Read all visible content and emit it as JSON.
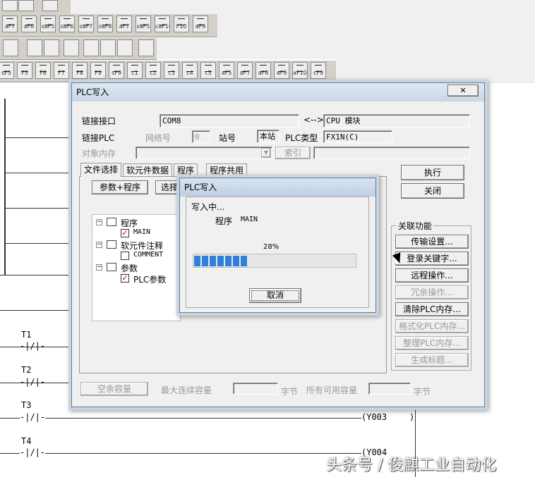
{
  "toolbar": {
    "row2": [
      "aF7",
      "aF8",
      "saF5",
      "saF6",
      "saF7",
      "saF8",
      "aF7",
      "saF5",
      "caF10",
      "F10",
      "aF9"
    ],
    "row4": [
      "sF5",
      "F5",
      "F6",
      "F7",
      "F8",
      "F9",
      "sF9",
      "c1",
      "c2",
      "c3",
      "c4",
      "c5",
      "aF5",
      "aF7",
      "aF8",
      "aF9",
      "aF10",
      "cF9"
    ]
  },
  "ladder": {
    "contacts": [
      "T1",
      "T2",
      "T3",
      "T4"
    ],
    "coils": [
      "Y003",
      "Y004"
    ]
  },
  "dialog": {
    "title": "PLC写入",
    "close_glyph": "✕",
    "link_port_label": "链接接口",
    "link_port_value": "COM8",
    "arrow": "<-->",
    "cpu_module": "CPU 模块",
    "link_plc_label": "链接PLC",
    "network_no_label": "网络号",
    "network_no_value": "0",
    "station_label": "站号",
    "station_value": "本站",
    "plc_type_label": "PLC类型",
    "plc_type_value": "FX1N(C)",
    "target_memory_label": "对象内存",
    "index_button": "索引",
    "tabs": [
      "文件选择",
      "软元件数据",
      "程序",
      "程序共用"
    ],
    "param_program_button": "参数+程序",
    "select_button": "选择",
    "tree": {
      "program": "程序",
      "main": "MAIN",
      "device_comment": "软元件注释",
      "comment": "COMMENT",
      "params": "参数",
      "plc_params": "PLC参数"
    },
    "execute_button": "执行",
    "close_button": "关闭",
    "related_title": "关联功能",
    "related_buttons": [
      "传输设置...",
      "登录关键字...",
      "远程操作...",
      "冗余操作...",
      "清除PLC内存...",
      "格式化PLC内存...",
      "整理PLC内存...",
      "生成标题..."
    ],
    "related_enabled": [
      true,
      true,
      true,
      false,
      true,
      false,
      false,
      false
    ],
    "free_capacity_button": "空余容量",
    "max_continuous_label": "最大连续容量",
    "bytes_unit": "字节",
    "total_free_label": "所有可用容量"
  },
  "progress_dialog": {
    "title": "PLC写入",
    "writing": "写入中...",
    "program_label": "程序",
    "program_name": "MAIN",
    "percent_text": "28%",
    "progress": 0.28,
    "segments": 7,
    "cancel_button": "取消"
  },
  "watermark": "头条号 / 俊麒工业自动化",
  "colors": {
    "progress_fill": "#2f80dc",
    "check_mark": "#d00000",
    "toolbar_bg": "#d4d0c8"
  }
}
